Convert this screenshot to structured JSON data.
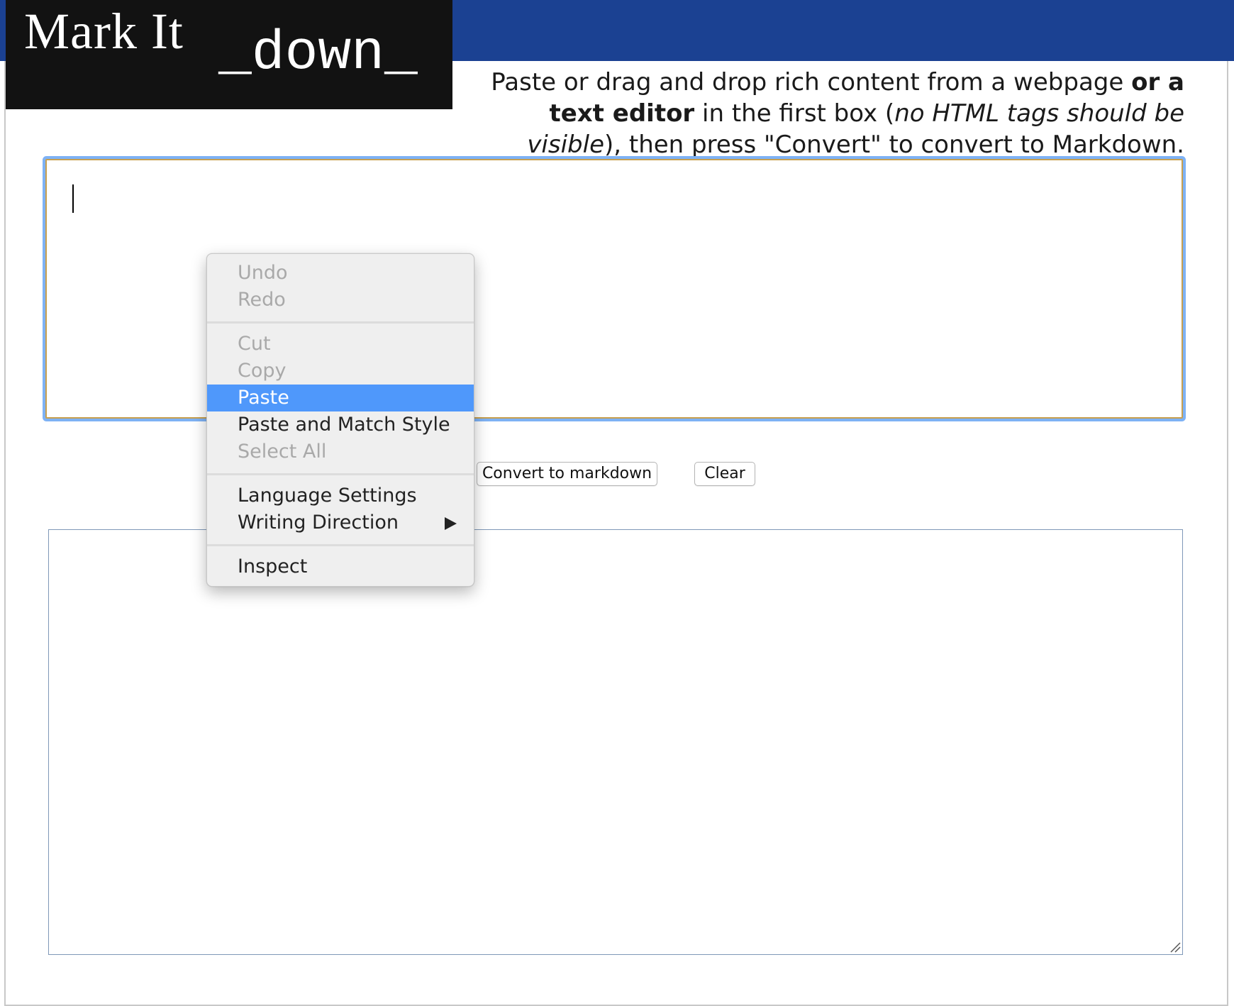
{
  "colors": {
    "header_band": "#1b4192",
    "logo_background": "#121212",
    "focus_ring": "#7eb2f5",
    "menu_highlight": "#4f98fb"
  },
  "logo": {
    "main_text": "Mark It",
    "accent_text": "_down_"
  },
  "intro": {
    "part1": "Paste or drag and drop rich content from a webpage ",
    "bold1": "or a text editor",
    "part2": " in the first box (",
    "italic1": "no HTML tags should be visible",
    "part3": "), then press \"Convert\" to convert to Markdown."
  },
  "input_box": {
    "value": ""
  },
  "buttons": {
    "convert_label": "Convert to markdown",
    "clear_label": "Clear"
  },
  "output_box": {
    "value": ""
  },
  "context_menu": {
    "undo": "Undo",
    "redo": "Redo",
    "cut": "Cut",
    "copy": "Copy",
    "paste": "Paste",
    "paste_match_style": "Paste and Match Style",
    "select_all": "Select All",
    "language_settings": "Language Settings",
    "writing_direction": "Writing Direction",
    "inspect": "Inspect",
    "submenu_icon": "triangle-right-icon"
  }
}
